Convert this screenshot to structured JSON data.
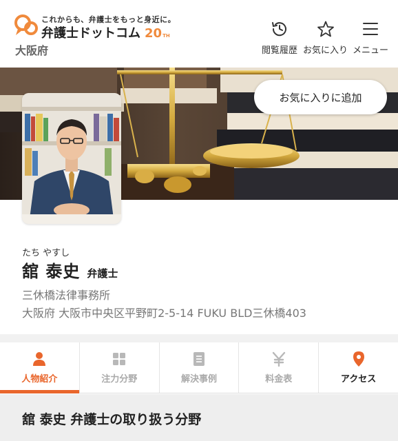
{
  "header": {
    "tagline": "これからも、弁護士をもっと身近に。",
    "brand": "弁護士ドットコム",
    "anniversary": "20",
    "anniversary_suffix": "TH",
    "region": "大阪府",
    "nav": {
      "history_label": "閲覧履歴",
      "favorites_label": "お気に入り",
      "menu_label": "メニュー"
    }
  },
  "hero": {
    "add_favorite_label": "お気に入りに追加"
  },
  "profile": {
    "kana": "たち やすし",
    "name": "舘 泰史",
    "title": "弁護士",
    "office": "三休橋法律事務所",
    "address": "大阪府 大阪市中央区平野町2-5-14 FUKU BLD三休橋403"
  },
  "tabs": [
    {
      "label": "人物紹介",
      "icon": "person-icon",
      "active": true
    },
    {
      "label": "注力分野",
      "icon": "grid-icon",
      "active": false
    },
    {
      "label": "解決事例",
      "icon": "document-icon",
      "active": false
    },
    {
      "label": "料金表",
      "icon": "yen-icon",
      "active": false
    },
    {
      "label": "アクセス",
      "icon": "map-pin-icon",
      "active": false
    }
  ],
  "section": {
    "title": "舘 泰史 弁護士の取り扱う分野"
  },
  "colors": {
    "accent": "#e9662c",
    "logo_orange": "#f08a3c"
  }
}
